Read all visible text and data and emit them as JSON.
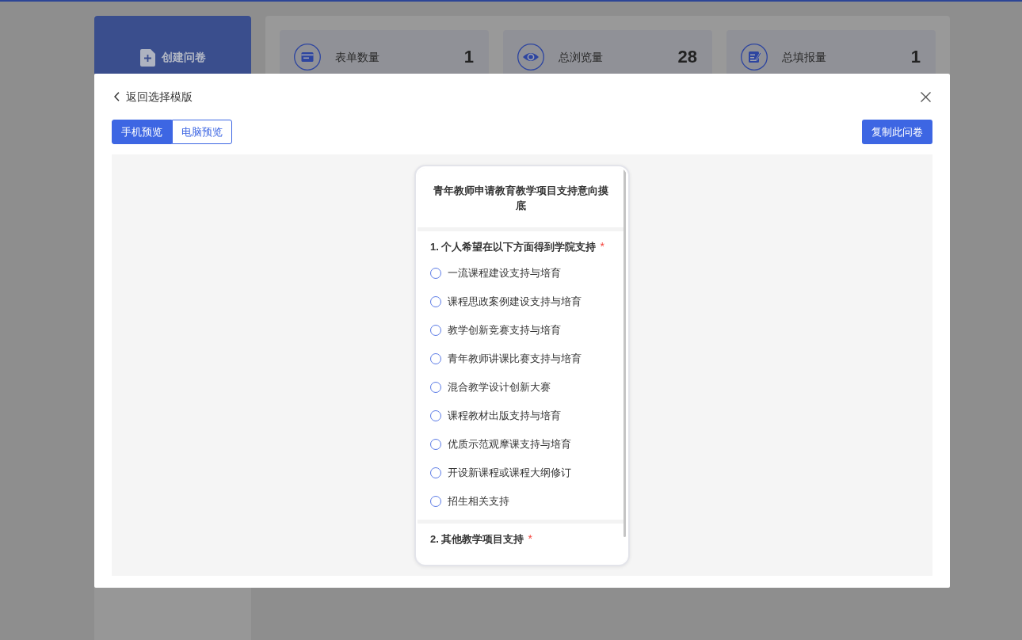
{
  "sidebar": {
    "create_button": "创建问卷"
  },
  "stats": [
    {
      "label": "表单数量",
      "value": "1"
    },
    {
      "label": "总浏览量",
      "value": "28"
    },
    {
      "label": "总填报量",
      "value": "1"
    }
  ],
  "dialog": {
    "back_link": "返回选择模版",
    "preview_tabs": [
      {
        "label": "手机预览",
        "selected": true
      },
      {
        "label": "电脑预览",
        "selected": false
      }
    ],
    "copy_button": "复制此问卷",
    "survey": {
      "title": "青年教师申请教育教学项目支持意向摸底",
      "questions": [
        {
          "title": "1. 个人希望在以下方面得到学院支持",
          "required_mark": "*",
          "options": [
            {
              "label": "一流课程建设支持与培育",
              "selected": false
            },
            {
              "label": "课程思政案例建设支持与培育",
              "selected": false
            },
            {
              "label": "教学创新竞赛支持与培育",
              "selected": false
            },
            {
              "label": "青年教师讲课比赛支持与培育",
              "selected": false
            },
            {
              "label": "混合教学设计创新大赛",
              "selected": false
            },
            {
              "label": "课程教材出版支持与培育",
              "selected": false
            },
            {
              "label": "优质示范观摩课支持与培育",
              "selected": false
            },
            {
              "label": "开设新课程或课程大纲修订",
              "selected": false
            },
            {
              "label": "招生相关支持",
              "selected": false
            }
          ]
        },
        {
          "title": "2. 其他教学项目支持",
          "required_mark": "*"
        }
      ]
    }
  }
}
